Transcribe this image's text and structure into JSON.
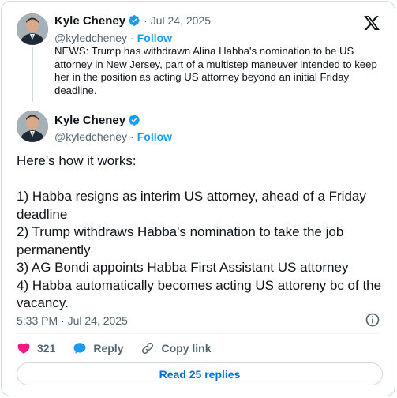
{
  "quoted": {
    "name": "Kyle Cheney",
    "date": "Jul 24, 2025",
    "handle": "@kyledcheney",
    "follow": "Follow",
    "text": "NEWS: Trump has withdrawn Alina Habba's nomination to be US attorney in New Jersey, part of a multistep maneuver intended to keep her in the position as acting US attorney beyond an initial Friday deadline."
  },
  "tweet": {
    "name": "Kyle Cheney",
    "handle": "@kyledcheney",
    "follow": "Follow",
    "text": "Here's how it works:\n\n1) Habba resigns as interim US attorney, ahead of a Friday deadline\n2) Trump withdraws Habba's nomination to take the job permanently\n3) AG Bondi appoints Habba First Assistant US attorney\n4) Habba automatically becomes acting US attoreny bc of the vacancy.",
    "timestamp": "5:33 PM · Jul 24, 2025"
  },
  "actions": {
    "likes": "321",
    "reply": "Reply",
    "copy_link": "Copy link"
  },
  "read_replies": "Read 25 replies",
  "colors": {
    "accent": "#1d9bf0",
    "link": "#006fd6",
    "like": "#f91880",
    "text": "#0f1419",
    "muted": "#536471",
    "border": "#cfd9de"
  },
  "icons": {
    "verified": "verified-badge-icon",
    "x_logo": "x-logo-icon",
    "info": "info-icon",
    "like": "heart-icon",
    "reply": "reply-bubble-icon",
    "copy_link": "link-icon"
  }
}
